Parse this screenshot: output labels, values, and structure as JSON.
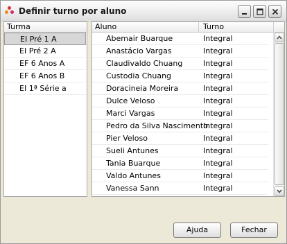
{
  "window": {
    "title": "Definir turno por aluno",
    "icon": "app-dots-icon",
    "controls": [
      "minimize-icon",
      "maximize-icon",
      "close-icon"
    ]
  },
  "turma_list": {
    "header": "Turma",
    "items": [
      {
        "label": "EI Pré 1 A",
        "selected": true
      },
      {
        "label": "EI Pré 2 A",
        "selected": false
      },
      {
        "label": "EF 6 Anos A",
        "selected": false
      },
      {
        "label": "EF 6 Anos B",
        "selected": false
      },
      {
        "label": "EI 1ª Série a",
        "selected": false
      }
    ]
  },
  "aluno_table": {
    "headers": {
      "aluno": "Aluno",
      "turno": "Turno"
    },
    "rows": [
      {
        "aluno": "Abemair Buarque",
        "turno": "Integral"
      },
      {
        "aluno": "Anastácio Vargas",
        "turno": "Integral"
      },
      {
        "aluno": "Claudivaldo Chuang",
        "turno": "Integral"
      },
      {
        "aluno": "Custodia Chuang",
        "turno": "Integral"
      },
      {
        "aluno": "Doracineia Moreira",
        "turno": "Integral"
      },
      {
        "aluno": "Dulce Veloso",
        "turno": "Integral"
      },
      {
        "aluno": "Marci Vargas",
        "turno": "Integral"
      },
      {
        "aluno": "Pedro da Silva Nascimento",
        "turno": "Integral"
      },
      {
        "aluno": "Pier Veloso",
        "turno": "Integral"
      },
      {
        "aluno": "Sueli Antunes",
        "turno": "Integral"
      },
      {
        "aluno": "Tania Buarque",
        "turno": "Integral"
      },
      {
        "aluno": "Valdo Antunes",
        "turno": "Integral"
      },
      {
        "aluno": "Vanessa Sann",
        "turno": "Integral"
      }
    ]
  },
  "buttons": {
    "help": "Ajuda",
    "close": "Fechar"
  },
  "colors": {
    "selection": "#d7d7d7",
    "window_bg": "#ece9d8",
    "icon_dots": [
      "#e03030",
      "#f08a1c",
      "#d02a6a"
    ]
  }
}
